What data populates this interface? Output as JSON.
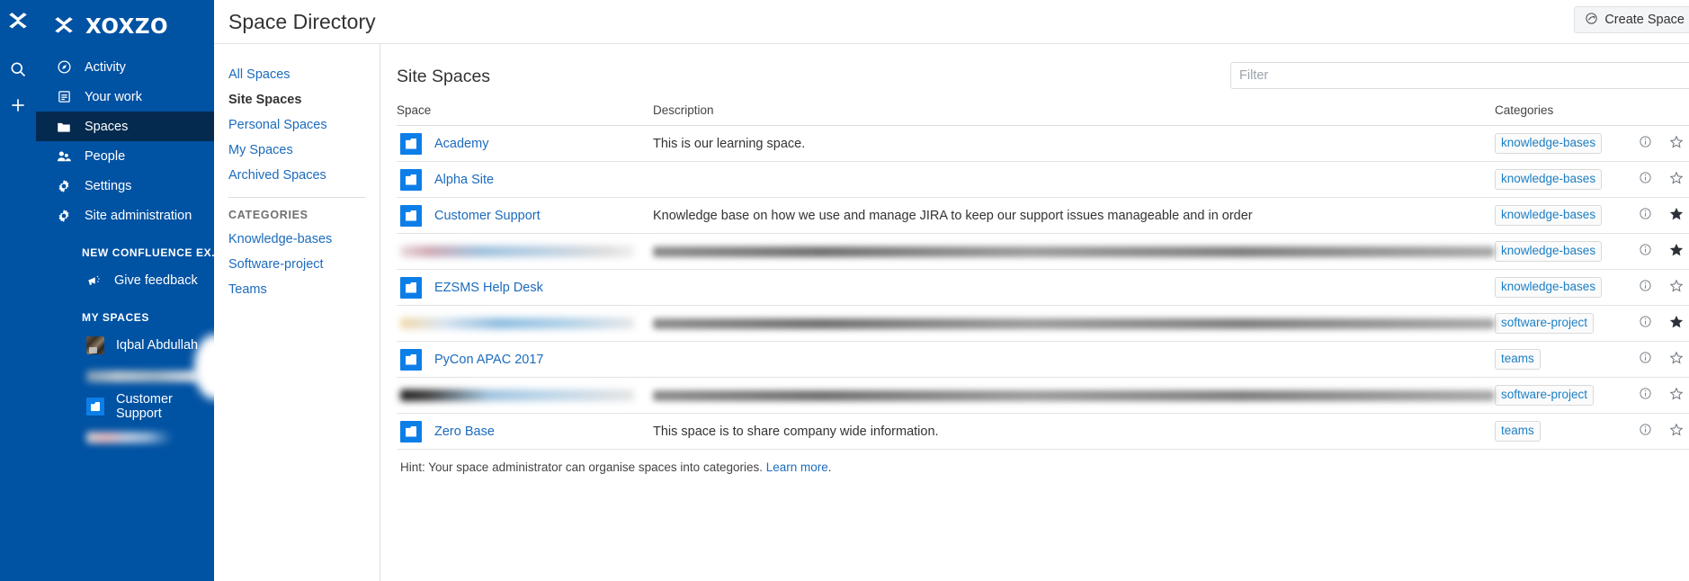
{
  "brand": {
    "name": "XOXZO",
    "logo_icon": "xoxzo-logo-icon"
  },
  "global_rail": {
    "items": [
      {
        "icon": "xoxzo-mark-icon",
        "name": "home-logo"
      },
      {
        "icon": "search-icon",
        "name": "search"
      },
      {
        "icon": "plus-icon",
        "name": "create"
      }
    ]
  },
  "sidebar": {
    "nav": [
      {
        "label": "Activity",
        "icon": "compass-icon",
        "selected": false
      },
      {
        "label": "Your work",
        "icon": "document-icon",
        "selected": false
      },
      {
        "label": "Spaces",
        "icon": "folder-icon",
        "selected": true
      },
      {
        "label": "People",
        "icon": "people-icon",
        "selected": false
      },
      {
        "label": "Settings",
        "icon": "gear-icon",
        "selected": false
      },
      {
        "label": "Site administration",
        "icon": "gear-icon",
        "selected": false
      }
    ],
    "new_experience_heading": "NEW CONFLUENCE EX...",
    "feedback": {
      "label": "Give feedback",
      "icon": "megaphone-icon"
    },
    "my_spaces_heading": "MY SPACES",
    "my_spaces": [
      {
        "label": "Iqbal Abdullah",
        "icon": "user-avatar",
        "redacted": false
      },
      {
        "label": "",
        "icon": "space-icon",
        "redacted": true
      },
      {
        "label": "Customer Support",
        "icon": "space-icon",
        "redacted": false
      },
      {
        "label": "",
        "icon": "space-icon",
        "redacted": true
      }
    ]
  },
  "header": {
    "title": "Space Directory",
    "create_space_label": "Create Space",
    "create_space_icon": "create-space-icon"
  },
  "secondary_nav": {
    "links": [
      {
        "label": "All Spaces",
        "active": false
      },
      {
        "label": "Site Spaces",
        "active": true
      },
      {
        "label": "Personal Spaces",
        "active": false
      },
      {
        "label": "My Spaces",
        "active": false
      },
      {
        "label": "Archived Spaces",
        "active": false
      }
    ],
    "categories_heading": "CATEGORIES",
    "categories": [
      {
        "label": "Knowledge-bases"
      },
      {
        "label": "Software-project"
      },
      {
        "label": "Teams"
      }
    ]
  },
  "main": {
    "panel_title": "Site Spaces",
    "filter": {
      "placeholder": "Filter",
      "value": ""
    },
    "columns": {
      "space": "Space",
      "description": "Description",
      "categories": "Categories"
    },
    "rows": [
      {
        "name": "Academy",
        "description": "This is our learning space.",
        "category": "knowledge-bases",
        "favorite": false,
        "redacted": false
      },
      {
        "name": "Alpha Site",
        "description": "",
        "category": "knowledge-bases",
        "favorite": false,
        "redacted": false
      },
      {
        "name": "Customer Support",
        "description": "Knowledge base on how we use and manage JIRA to keep our support issues manageable and in order",
        "category": "knowledge-bases",
        "favorite": true,
        "redacted": false
      },
      {
        "name": "",
        "description": "",
        "category": "knowledge-bases",
        "favorite": true,
        "redacted": true,
        "redact_style": "rn-1"
      },
      {
        "name": "EZSMS Help Desk",
        "description": "",
        "category": "knowledge-bases",
        "favorite": false,
        "redacted": false
      },
      {
        "name": "",
        "description": "",
        "category": "software-project",
        "favorite": true,
        "redacted": true,
        "redact_style": "rn-2"
      },
      {
        "name": "PyCon APAC 2017",
        "description": "",
        "category": "teams",
        "favorite": false,
        "redacted": false
      },
      {
        "name": "",
        "description": "",
        "category": "software-project",
        "favorite": false,
        "redacted": true,
        "redact_style": "rn-3"
      },
      {
        "name": "Zero Base",
        "description": "This space is to share company wide information.",
        "category": "teams",
        "favorite": false,
        "redacted": false
      }
    ],
    "hint_text": "Hint: Your space administrator can organise spaces into categories.",
    "hint_link": "Learn more",
    "hint_suffix": "."
  },
  "colors": {
    "sidebar_blue": "#0052a3",
    "selected_nav": "#042a4f",
    "link_blue": "#1c6bbd",
    "tile_blue": "#0c7ee8",
    "tag_text": "#1c7fc4"
  }
}
